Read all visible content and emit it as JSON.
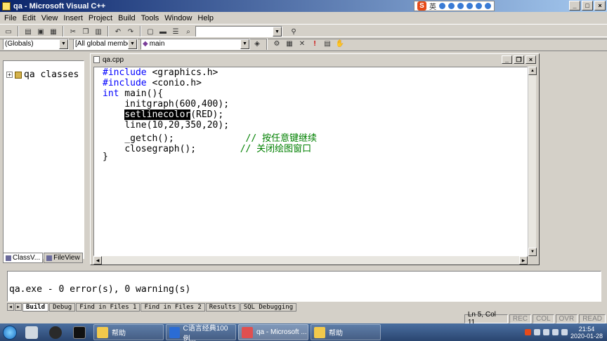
{
  "window": {
    "title": "qa - Microsoft Visual C++"
  },
  "ime": {
    "logo": "S",
    "lang": "英"
  },
  "menu": [
    "File",
    "Edit",
    "View",
    "Insert",
    "Project",
    "Build",
    "Tools",
    "Window",
    "Help"
  ],
  "toolbar": {
    "find_value": ""
  },
  "wizardbar": {
    "scope": "(Globals)",
    "members": "[All global members",
    "function": "main"
  },
  "workspace": {
    "tree_root": "qa classes",
    "tabs": [
      "ClassV...",
      "FileView"
    ]
  },
  "editor": {
    "title": "qa.cpp",
    "code": [
      {
        "kw": "#include",
        "rest": " <graphics.h>"
      },
      {
        "kw": "#include",
        "rest": " <conio.h>"
      },
      {
        "kw": "int",
        "rest": " main(){"
      },
      {
        "indent": "    ",
        "text": "initgraph(600,400);"
      },
      {
        "indent": "    ",
        "hl": "setlinecolor",
        "text": "(RED);"
      },
      {
        "indent": "    ",
        "text": "line(10,20,350,20);"
      },
      {
        "indent": "    ",
        "text": "_getch();",
        "pad": "             ",
        "comment": "// 按任意键继续"
      },
      {
        "indent": "    ",
        "text": "closegraph();",
        "pad": "        ",
        "comment": "// 关闭绘图窗口"
      },
      {
        "text": "}"
      }
    ]
  },
  "output": {
    "text": "qa.exe - 0 error(s), 0 warning(s)",
    "tabs": [
      "Build",
      "Debug",
      "Find in Files 1",
      "Find in Files 2",
      "Results",
      "SQL Debugging"
    ]
  },
  "status": {
    "position": "Ln 5, Col 11",
    "indicators": [
      "REC",
      "COL",
      "OVR",
      "READ"
    ]
  },
  "taskbar": {
    "tasks": [
      {
        "label": "帮助",
        "color": "#f2c94c"
      },
      {
        "label": "C语言经典100例...",
        "color": "#2b6cd4"
      },
      {
        "label": "qa - Microsoft ...",
        "color": "#e05050"
      },
      {
        "label": "帮助",
        "color": "#f2c94c"
      }
    ],
    "time": "21:54",
    "date": "2020-01-28"
  }
}
